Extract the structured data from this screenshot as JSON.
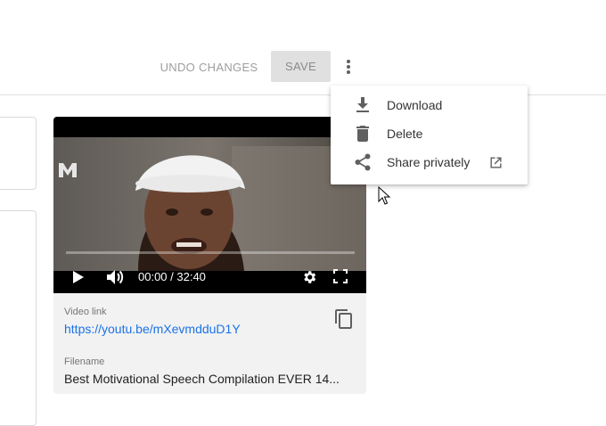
{
  "toolbar": {
    "undo_label": "UNDO CHANGES",
    "save_label": "SAVE"
  },
  "menu": {
    "items": [
      {
        "label": "Download",
        "icon": "download-icon"
      },
      {
        "label": "Delete",
        "icon": "trash-icon"
      },
      {
        "label": "Share privately",
        "icon": "share-icon",
        "trailing_icon": "external-link-icon"
      }
    ]
  },
  "player": {
    "time": "00:00 / 32:40",
    "controls": [
      "play-icon",
      "volume-icon",
      "settings-gear-icon",
      "fullscreen-icon"
    ]
  },
  "details": {
    "video_link_label": "Video link",
    "video_link": "https://youtu.be/mXevmdduD1Y",
    "filename_label": "Filename",
    "filename": "Best Motivational Speech Compilation EVER 14..."
  },
  "colors": {
    "link": "#1a73e8",
    "save_bg": "#e0e0e0",
    "card_bg": "#f2f2f2"
  }
}
